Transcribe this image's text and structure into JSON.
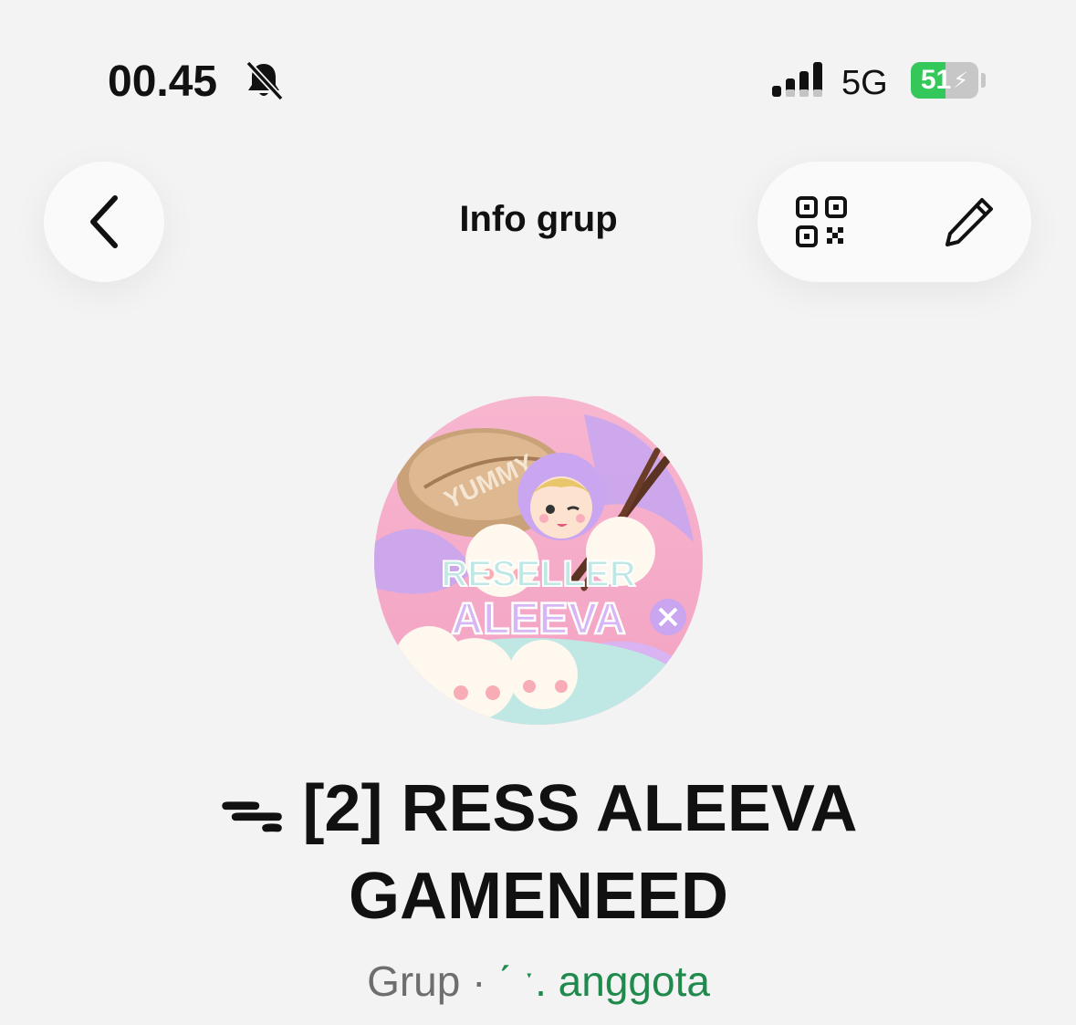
{
  "status_bar": {
    "time": "00.45",
    "network": "5G",
    "battery_level": "51",
    "battery_percent": 51,
    "icons": [
      "bell-off-icon",
      "signal-icon",
      "battery-charging-icon"
    ]
  },
  "header": {
    "title": "Info grup",
    "back_icon": "chevron-left-icon",
    "qr_icon": "qr-code-icon",
    "edit_icon": "pencil-icon"
  },
  "group": {
    "avatar_text_top": "YUMMY",
    "avatar_text_line1": "RESELLER",
    "avatar_text_line2": "ALEEVA",
    "name_icon": "ribbon-glyph",
    "name": "ᯓ [2] RESS ALEEVA GAMENEED",
    "meta_prefix": "Grup · ",
    "member_count": "ˊ ˑ. anggota"
  },
  "colors": {
    "background": "#f3f3f3",
    "accent_green": "#1f8a4c",
    "battery_green": "#34c759",
    "avatar_pink": "#f6a9c8",
    "avatar_lilac": "#c9a6ef"
  }
}
